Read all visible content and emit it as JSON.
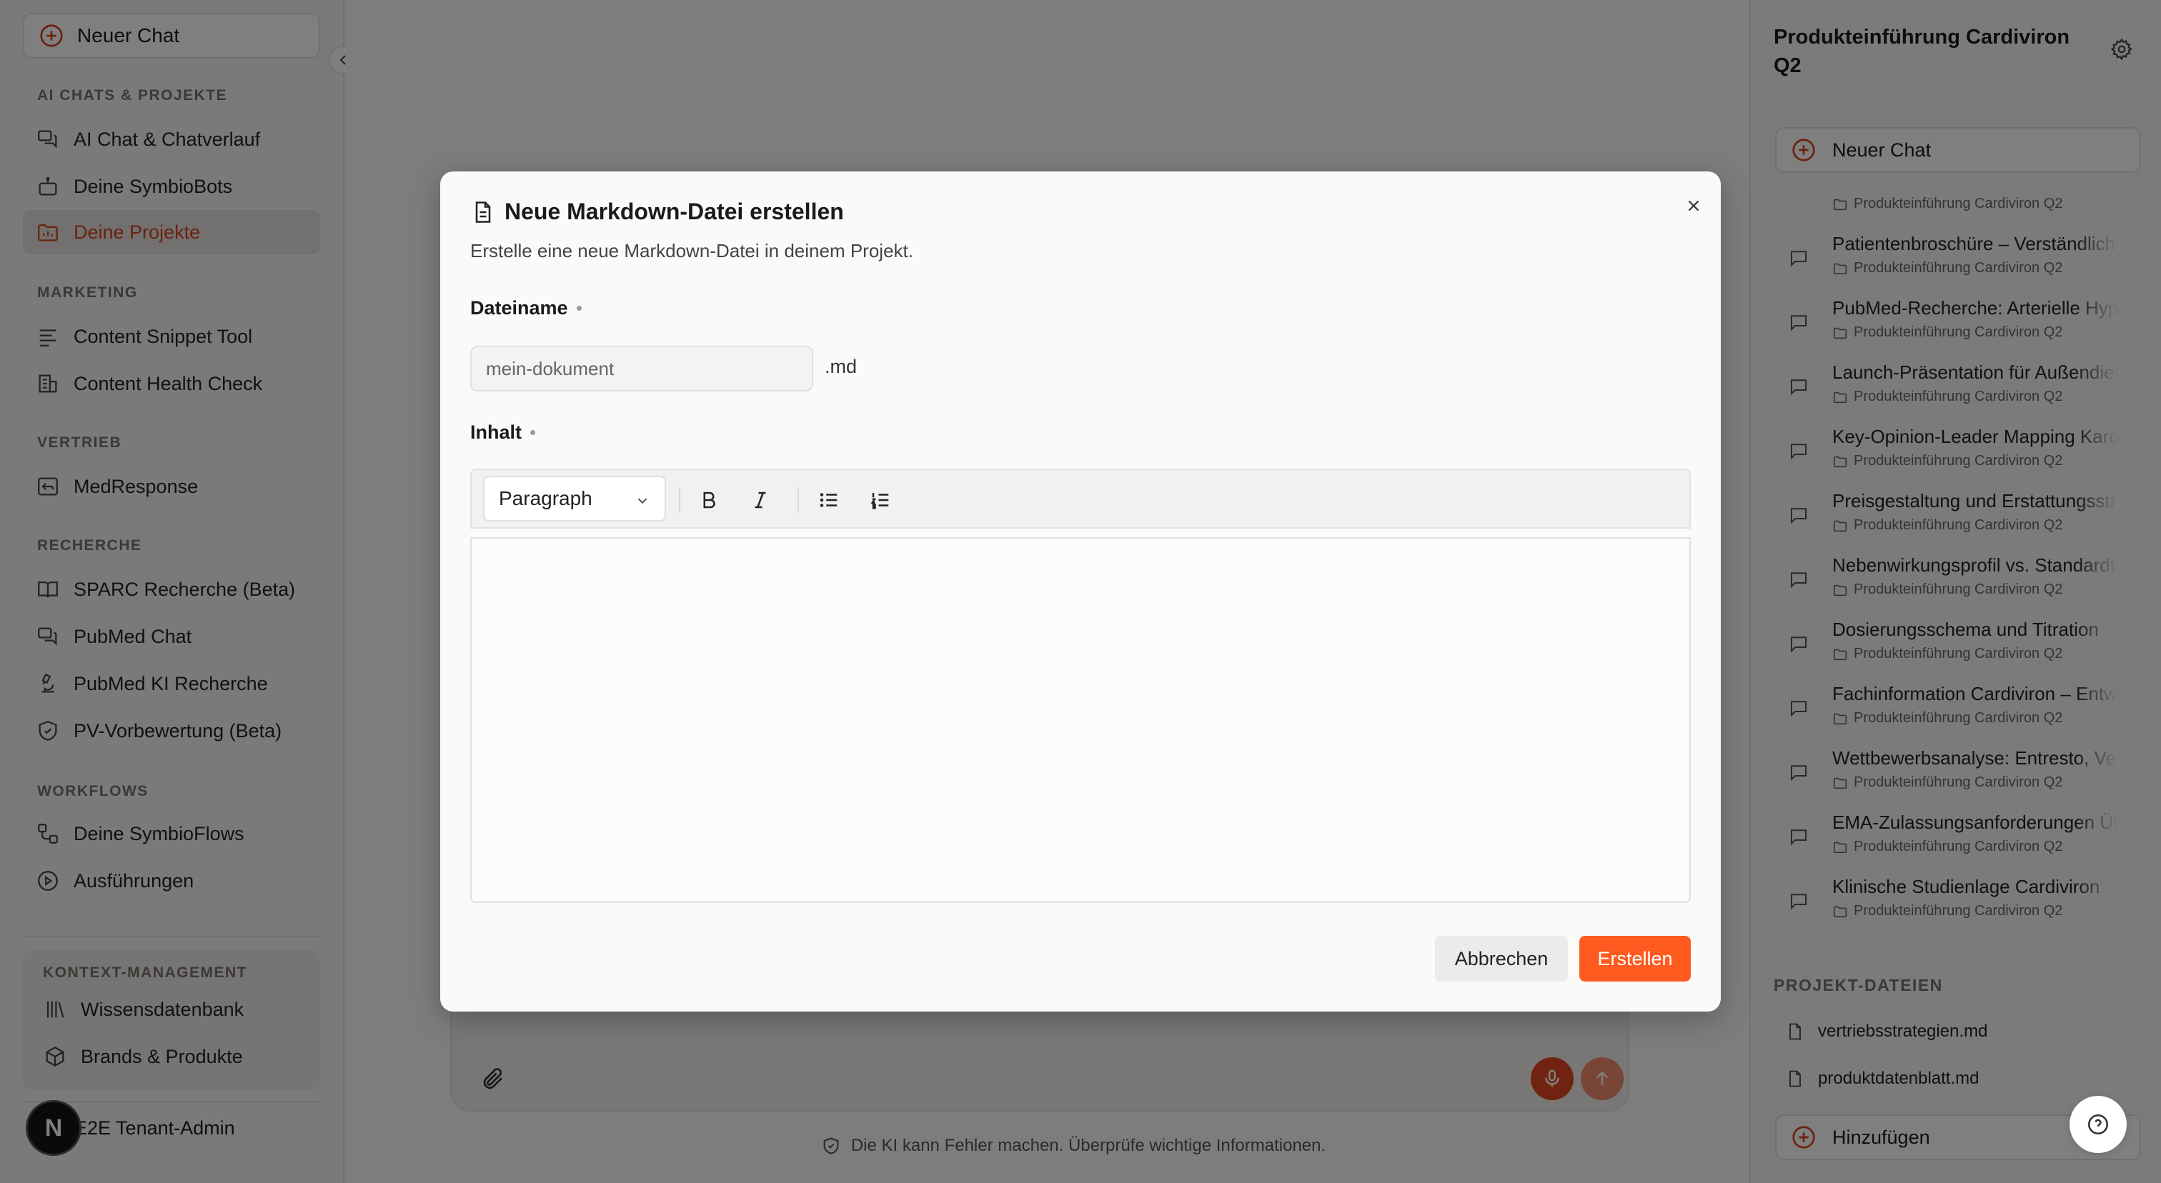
{
  "sidebar": {
    "new_chat": "Neuer Chat",
    "sections": {
      "ai_chats": "AI CHATS & PROJEKTE",
      "marketing": "MARKETING",
      "vertrieb": "VERTRIEB",
      "recherche": "RECHERCHE",
      "workflows": "WORKFLOWS",
      "kontext": "KONTEXT-MANAGEMENT"
    },
    "items": {
      "ai_chat": "AI Chat & Chatverlauf",
      "symbiobots": "Deine SymbioBots",
      "projekte": "Deine Projekte",
      "snippet": "Content Snippet Tool",
      "health": "Content Health Check",
      "medresponse": "MedResponse",
      "sparc": "SPARC Recherche (Beta)",
      "pubmed_chat": "PubMed Chat",
      "pubmed_ki": "PubMed KI Recherche",
      "pv": "PV-Vorbewertung (Beta)",
      "symbioflows": "Deine SymbioFlows",
      "ausfuehren": "Ausführungen",
      "wissen": "Wissensdatenbank",
      "brands": "Brands & Produkte"
    },
    "user_name": "E2E Tenant-Admin",
    "avatar_letter": "N",
    "accent_color": "#d9431f"
  },
  "main": {
    "disclaimer": "Die KI kann Fehler machen. Überprüfe wichtige Informationen."
  },
  "right_panel": {
    "title": "Produkteinführung Cardiviron Q2",
    "new_chat": "Neuer Chat",
    "folder": "Produkteinführung Cardiviron Q2",
    "chats": [
      "Patientenbroschüre – Verständliche Erklärung",
      "PubMed-Recherche: Arterielle Hypertonie",
      "Launch-Präsentation für Außendienst",
      "Key-Opinion-Leader Mapping Kardiologie",
      "Preisgestaltung und Erstattungsstrategie",
      "Nebenwirkungsprofil vs. Standardtherapie",
      "Dosierungsschema und Titration",
      "Fachinformation Cardiviron – Entwurf",
      "Wettbewerbsanalyse: Entresto, Verquvo",
      "EMA-Zulassungsanforderungen Überblick",
      "Klinische Studienlage Cardiviron"
    ],
    "files_title": "PROJEKT-DATEIEN",
    "files": [
      "vertriebsstrategien.md",
      "produktdatenblatt.md"
    ],
    "add_label": "Hinzufügen"
  },
  "modal": {
    "title": "Neue Markdown-Datei erstellen",
    "description": "Erstelle eine neue Markdown-Datei in deinem Projekt.",
    "filename_label": "Dateiname",
    "filename_placeholder": "mein-dokument",
    "filename_value": "",
    "extension": ".md",
    "content_label": "Inhalt",
    "block_type": "Paragraph",
    "cancel": "Abbrechen",
    "create": "Erstellen",
    "primary_color": "#ff5a1f"
  }
}
